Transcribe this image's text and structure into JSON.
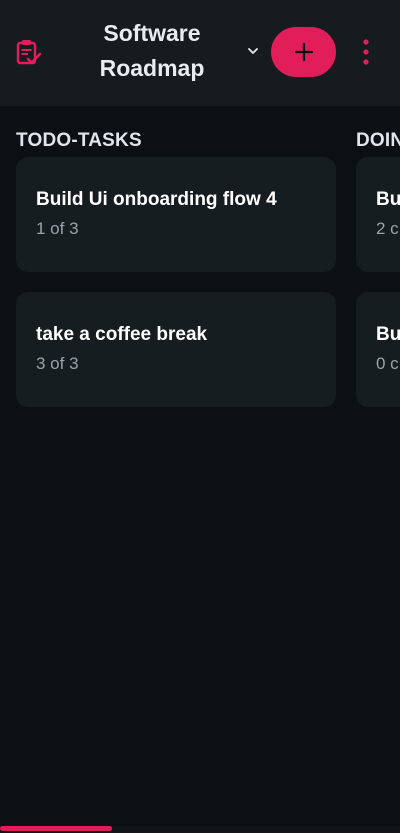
{
  "header": {
    "logo_icon": "clipboard-check-icon",
    "title_line1": "Software",
    "title_line2": "Roadmap",
    "dropdown_icon": "chevron-down-icon",
    "add_icon": "plus-icon",
    "menu_icon": "more-vertical-icon",
    "accent": "#e11d5a"
  },
  "columns": [
    {
      "title": "TODO-TASKS",
      "cards": [
        {
          "title": "Build Ui onboarding flow 4",
          "subtasks": "1 of 3"
        },
        {
          "title": "take a coffee break",
          "subtasks": "3 of 3"
        }
      ]
    },
    {
      "title": "DOIN",
      "cards": [
        {
          "title": "Bu",
          "subtasks": "2 c"
        },
        {
          "title": "Bu",
          "subtasks": "0 c"
        }
      ]
    }
  ],
  "scroll": {
    "position_fraction": 0.28
  }
}
